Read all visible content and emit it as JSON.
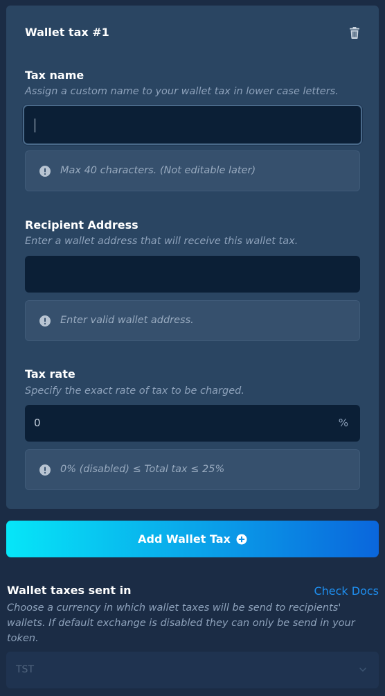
{
  "wallet_tax": {
    "title": "Wallet tax #1",
    "tax_name": {
      "label": "Tax name",
      "description": "Assign a custom name to your wallet tax in lower case letters.",
      "value": "",
      "hint": "Max 40 characters. (Not editable later)"
    },
    "recipient": {
      "label": "Recipient Address",
      "description": "Enter a wallet address that will receive this wallet tax.",
      "value": "",
      "hint": "Enter valid wallet address."
    },
    "tax_rate": {
      "label": "Tax rate",
      "description": "Specify the exact rate of tax to be charged.",
      "value": "0",
      "suffix": "%",
      "hint": "0% (disabled) ≤ Total tax ≤ 25%"
    }
  },
  "add_button": {
    "label": "Add Wallet Tax"
  },
  "currency_section": {
    "title": "Wallet taxes sent in",
    "docs_link": "Check Docs",
    "description": "Choose a currency in which wallet taxes will be send to recipients' wallets. If default exchange is disabled they can only be send in your token.",
    "selected": "TST"
  },
  "colors": {
    "background": "#1b2c45",
    "card": "#2a4562",
    "input": "#0b1f36",
    "link": "#1e8ff0",
    "button_gradient_start": "#06e6f8",
    "button_gradient_end": "#0a66dc"
  }
}
